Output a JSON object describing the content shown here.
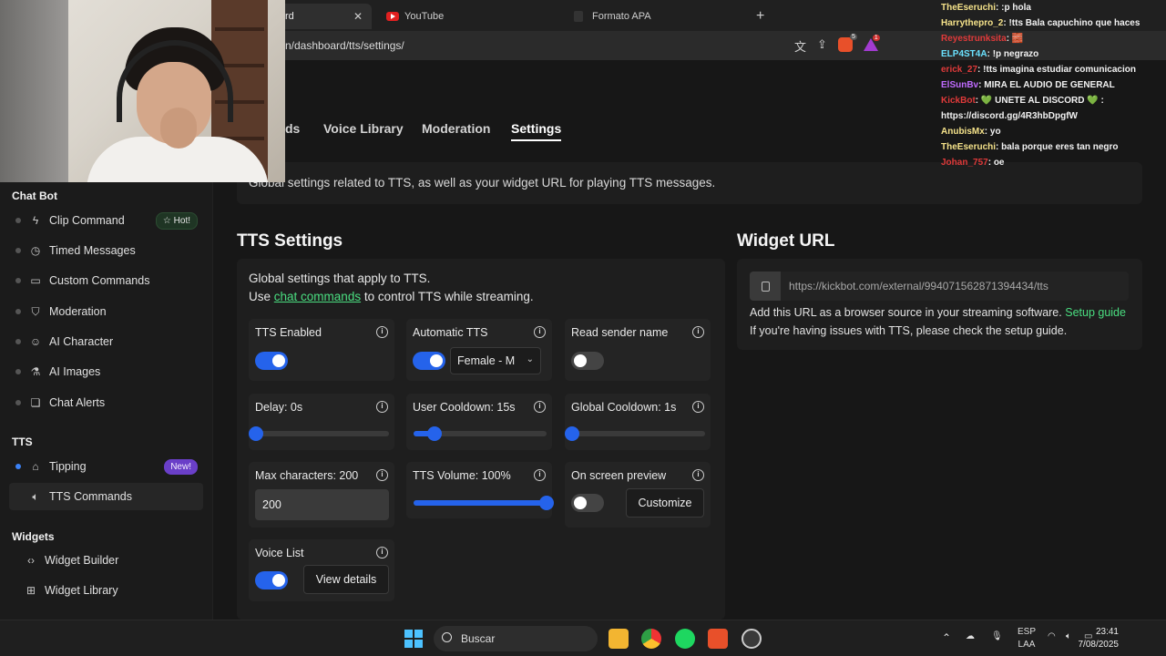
{
  "browser": {
    "tabs": [
      {
        "label": "rd",
        "active": true
      },
      {
        "label": "YouTube",
        "active": false
      },
      {
        "label": "Formato APA",
        "active": false
      }
    ],
    "new_tab": "+",
    "url": "n/dashboard/tts/settings/",
    "brave_count": "5",
    "rewards_count": "1"
  },
  "sidebar": {
    "chat_bot_heading": "Chat Bot",
    "chat_bot_items": [
      {
        "label": "Clip Command",
        "icon": "lightning-icon",
        "badge": "Hot!"
      },
      {
        "label": "Timed Messages",
        "icon": "timer-icon"
      },
      {
        "label": "Custom Commands",
        "icon": "command-icon"
      },
      {
        "label": "Moderation",
        "icon": "shield-icon"
      },
      {
        "label": "AI Character",
        "icon": "robot-icon"
      },
      {
        "label": "AI Images",
        "icon": "flask-icon"
      },
      {
        "label": "Chat Alerts",
        "icon": "gift-icon"
      }
    ],
    "tts_heading": "TTS",
    "tts_items": [
      {
        "label": "Tipping",
        "icon": "store-icon",
        "badge": "New!"
      },
      {
        "label": "TTS Commands",
        "icon": "speaker-icon"
      }
    ],
    "widgets_heading": "Widgets",
    "widget_items": [
      {
        "label": "Widget Builder",
        "icon": "code-icon"
      },
      {
        "label": "Widget Library",
        "icon": "grid-icon"
      }
    ]
  },
  "nav_tabs": [
    "ds",
    "Voice Library",
    "Moderation",
    "Settings"
  ],
  "description": "Global settings related to TTS, as well as your widget URL for playing TTS messages.",
  "tts": {
    "title": "TTS Settings",
    "intro_line1": "Global settings that apply to TTS.",
    "intro_use": "Use",
    "intro_link": "chat commands",
    "intro_rest": "to control TTS while streaming.",
    "tts_enabled": {
      "label": "TTS Enabled",
      "on": true
    },
    "automatic_tts": {
      "label": "Automatic TTS",
      "on": true,
      "voice": "Female - M"
    },
    "read_sender": {
      "label": "Read sender name",
      "on": false
    },
    "delay": {
      "label": "Delay: 0s",
      "fraction": 0.0
    },
    "user_cooldown": {
      "label": "User Cooldown: 15s",
      "fraction": 0.16
    },
    "global_cooldown": {
      "label": "Global Cooldown: 1s",
      "fraction": 0.0
    },
    "max_chars": {
      "label": "Max characters: 200",
      "value": "200"
    },
    "volume": {
      "label": "TTS Volume: 100%",
      "fraction": 1.0
    },
    "preview": {
      "label": "On screen preview",
      "on": false,
      "button": "Customize"
    },
    "voice_list": {
      "label": "Voice List",
      "on": true,
      "button": "View details"
    },
    "info_glyph": "i"
  },
  "widget": {
    "title": "Widget URL",
    "url": "https://kickbot.com/external/994071562871394434/tts",
    "line1": "Add this URL as a browser source in your streaming software.",
    "guide_link": "Setup guide",
    "line2": "If you're having issues with TTS, please check the setup guide."
  },
  "chat": [
    {
      "user": "TheEseruchi",
      "color": "#f5e28a",
      "msg": ":p hola"
    },
    {
      "user": "Harrythepro_2",
      "color": "#f5e28a",
      "msg": "!tts Bala capuchino que haces"
    },
    {
      "user": "Reyestrunksita",
      "color": "#e03a3a",
      "msg": "🧱"
    },
    {
      "user": "ELP4ST4A",
      "color": "#6be2ff",
      "msg": "!p negrazo"
    },
    {
      "user": "erick_27",
      "color": "#e03a3a",
      "msg": "!tts imagina estudiar comunicacion"
    },
    {
      "user": "ElSunBv",
      "color": "#c06bff",
      "msg": "MIRA EL AUDIO DE GENERAL"
    },
    {
      "user": "KickBot",
      "color": "#e03a3a",
      "msg": "💚 UNETE AL DISCORD 💚 : https://discord.gg/4R3hbDpgfW"
    },
    {
      "user": "AnubisMx",
      "color": "#f5e28a",
      "msg": "yo"
    },
    {
      "user": "TheEseruchi",
      "color": "#f5e28a",
      "msg": "bala porque eres tan negro"
    },
    {
      "user": "Johan_757",
      "color": "#e03a3a",
      "msg": "oe"
    }
  ],
  "taskbar": {
    "search": "Buscar",
    "lang_top": "ESP",
    "lang_bottom": "LAA",
    "time": "23:41",
    "date": "7/08/2025"
  }
}
